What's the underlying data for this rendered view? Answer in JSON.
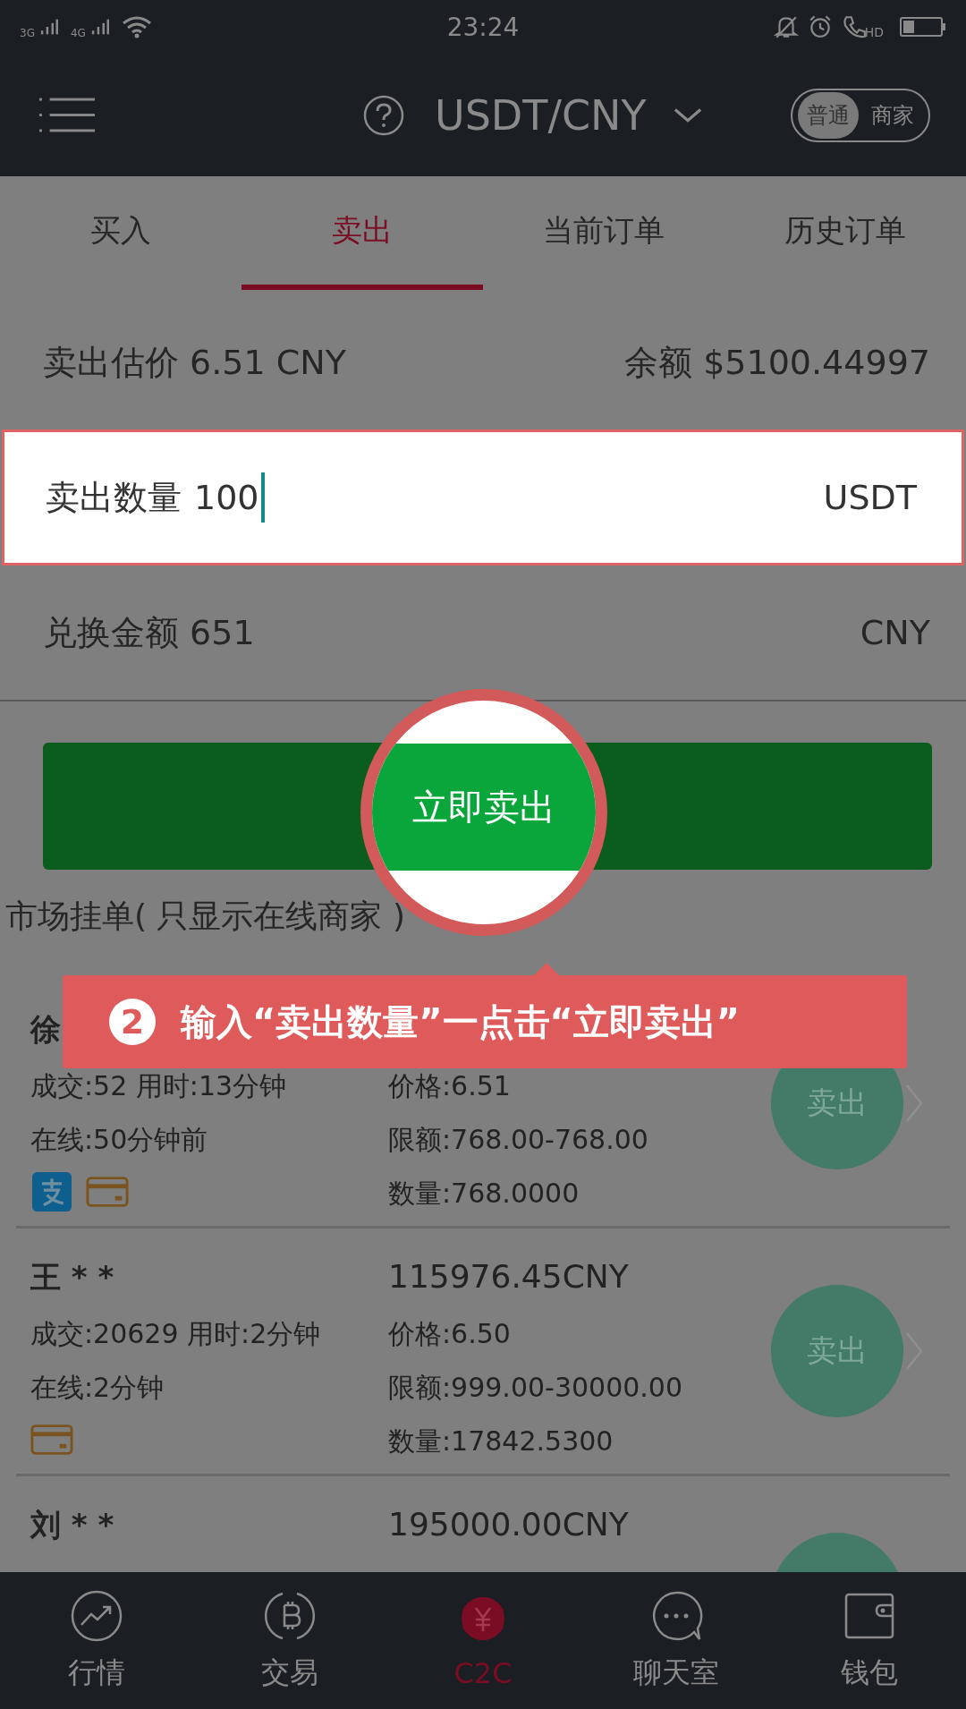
{
  "status_bar": {
    "network_1": "3G",
    "network_2": "4G",
    "time": "23:24",
    "call_badge": "HD"
  },
  "header": {
    "title": "USDT/CNY",
    "mode_toggle": [
      {
        "label": "普通",
        "selected": true
      },
      {
        "label": "商家",
        "selected": false
      }
    ]
  },
  "tabs": [
    {
      "label": "买入",
      "selected": false
    },
    {
      "label": "卖出",
      "selected": true
    },
    {
      "label": "当前订单",
      "selected": false
    },
    {
      "label": "历史订单",
      "selected": false
    }
  ],
  "estimate": {
    "price": "卖出估价 6.51 CNY",
    "balance": "余额 $5100.44997"
  },
  "quantity_field": {
    "label": "卖出数量",
    "value": "100",
    "unit": "USDT"
  },
  "exchange": {
    "label": "兑换金额 651",
    "unit": "CNY"
  },
  "sell_now_button": "立即卖出",
  "market_title": "市场挂单( 只显示在线商家 )",
  "tutorial": {
    "step": "2",
    "text": "输入“卖出数量”一点击“立即卖出”"
  },
  "listings": [
    {
      "name": "徐",
      "deals": "成交:52  用时:13分钟",
      "online": "在线:50分钟前",
      "price": "价格:6.51",
      "limit": "限额:768.00-768.00",
      "quantity": "数量:768.0000",
      "payments": [
        {
          "kind": "alipay"
        },
        {
          "kind": "card"
        }
      ],
      "action": "卖出"
    },
    {
      "name": "王 * *",
      "amount": "115976.45CNY",
      "deals": "成交:20629  用时:2分钟",
      "online": "在线:2分钟",
      "price": "价格:6.50",
      "limit": "限额:999.00-30000.00",
      "quantity": "数量:17842.5300",
      "payments": [
        {
          "kind": "card"
        }
      ],
      "action": "卖出"
    },
    {
      "name": "刘 * *",
      "amount": "195000.00CNY"
    }
  ],
  "bottom_nav": [
    {
      "label": "行情",
      "kind": "market",
      "selected": false
    },
    {
      "label": "交易",
      "kind": "trade",
      "selected": false
    },
    {
      "label": "C2C",
      "kind": "c2c",
      "selected": true
    },
    {
      "label": "聊天室",
      "kind": "chat",
      "selected": false
    },
    {
      "label": "钱包",
      "kind": "wallet",
      "selected": false
    }
  ]
}
